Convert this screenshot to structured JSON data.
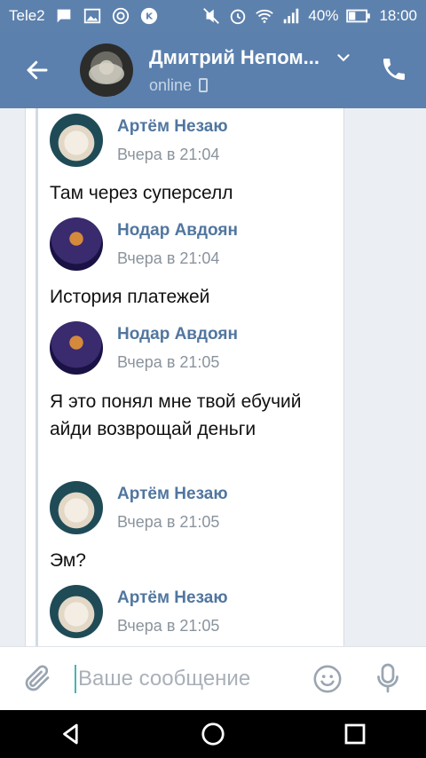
{
  "status_bar": {
    "carrier": "Tele2",
    "battery": "40%",
    "time": "18:00",
    "icons": [
      "chat-bubble-icon",
      "image-icon",
      "at-icon",
      "vk-icon",
      "mute-icon",
      "alarm-icon",
      "wifi-icon",
      "signal-icon",
      "battery-icon"
    ]
  },
  "header": {
    "name": "Дмитрий Непом...",
    "status": "online",
    "icons": [
      "back-arrow-icon",
      "chevron-down-icon",
      "phone-icon",
      "mobile-device-icon"
    ]
  },
  "messages": [
    {
      "author": "Артём Незаю",
      "time": "Вчера в 21:04",
      "text": "Там через суперселл",
      "avatar": "cat"
    },
    {
      "author": "Нодар Авдоян",
      "time": "Вчера в 21:04",
      "text": "История платежей",
      "avatar": "nodar"
    },
    {
      "author": "Нодар Авдоян",
      "time": "Вчера в 21:05",
      "text": "Я это понял мне твой ебучий айди возврощай деньги",
      "avatar": "nodar"
    },
    {
      "author": "Артём Незаю",
      "time": "Вчера в 21:05",
      "text": "Эм?",
      "avatar": "cat"
    },
    {
      "author": "Артём Незаю",
      "time": "Вчера в 21:05",
      "text": "",
      "avatar": "cat"
    }
  ],
  "input": {
    "placeholder": "Ваше сообщение",
    "value": ""
  },
  "colors": {
    "header_bg": "#5b80ad",
    "author": "#51769f",
    "time": "#8a939c",
    "caret": "#46b5b5"
  },
  "nav": [
    "back-triangle-icon",
    "home-circle-icon",
    "recents-square-icon"
  ]
}
